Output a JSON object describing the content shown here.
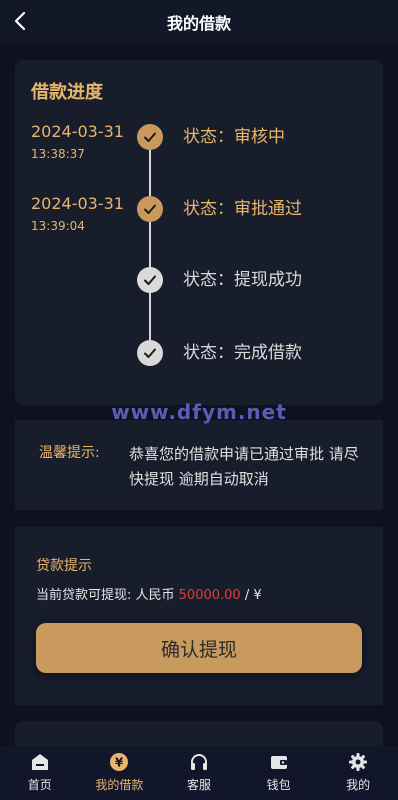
{
  "header": {
    "title": "我的借款"
  },
  "progress": {
    "title": "借款进度",
    "steps": [
      {
        "date": "2024-03-31",
        "time": "13:38:37",
        "status": "状态：审核中",
        "done": true
      },
      {
        "date": "2024-03-31",
        "time": "13:39:04",
        "status": "状态：审批通过",
        "done": true
      },
      {
        "date": "",
        "time": "",
        "status": "状态：提现成功",
        "done": false
      },
      {
        "date": "",
        "time": "",
        "status": "状态：完成借款",
        "done": false
      }
    ]
  },
  "watermark": "www.dfym.net",
  "tip": {
    "label": "温馨提示:",
    "text": "恭喜您的借款申请已通过审批 请尽快提现 逾期自动取消"
  },
  "loan": {
    "title": "贷款提示",
    "prefix": "当前贷款可提现: 人民币 ",
    "amount": "50000.00",
    "suffix": " / ¥",
    "button": "确认提现"
  },
  "tabbar": [
    {
      "label": "首页",
      "icon": "home-icon",
      "active": false
    },
    {
      "label": "我的借款",
      "icon": "yen-coin-icon",
      "active": true
    },
    {
      "label": "客服",
      "icon": "headset-icon",
      "active": false
    },
    {
      "label": "钱包",
      "icon": "wallet-icon",
      "active": false
    },
    {
      "label": "我的",
      "icon": "gear-icon",
      "active": false
    }
  ],
  "colors": {
    "accent": "#e8b56c",
    "button": "#c99a5e",
    "amount": "#e23b3b",
    "background": "#0e1220"
  }
}
